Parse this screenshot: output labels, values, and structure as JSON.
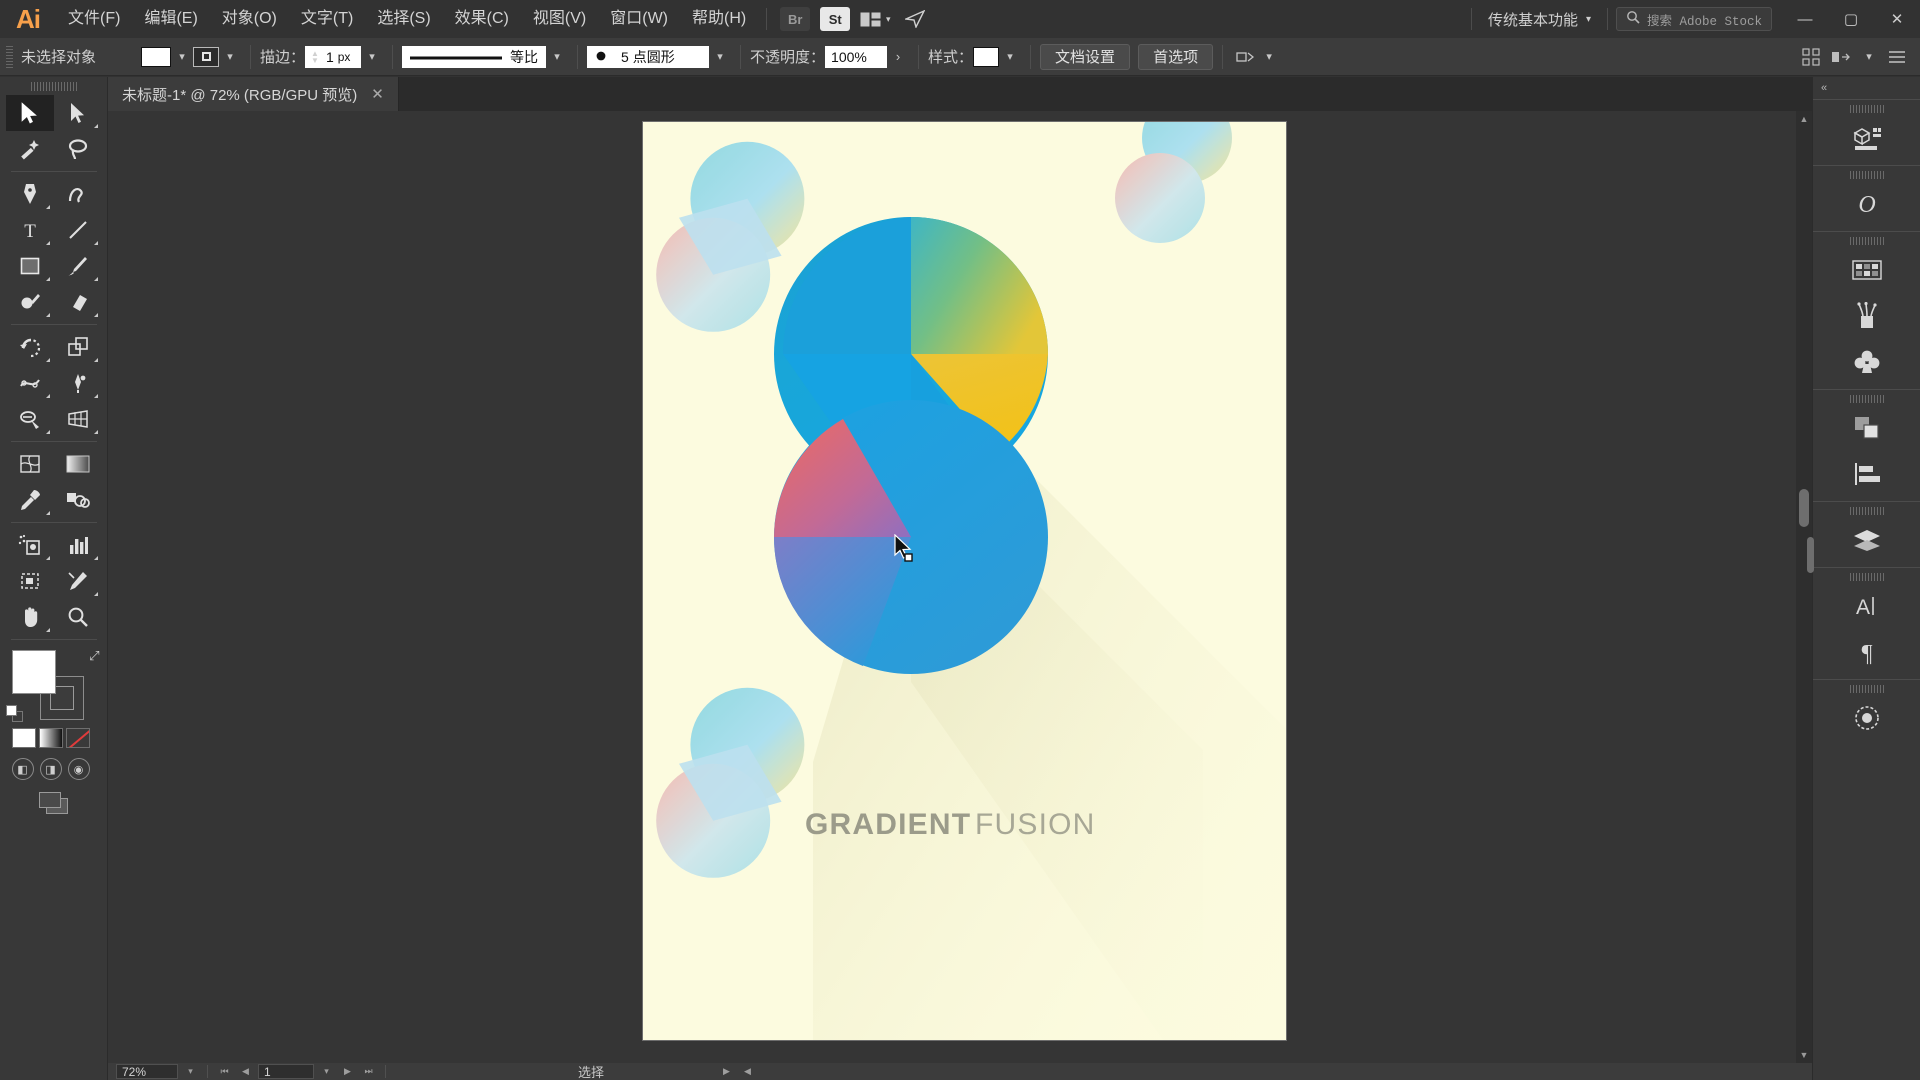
{
  "app": {
    "name": "Ai",
    "logo_color": "#f7a04b"
  },
  "menubar": {
    "items": [
      {
        "label": "文件(F)",
        "name": "file"
      },
      {
        "label": "编辑(E)",
        "name": "edit"
      },
      {
        "label": "对象(O)",
        "name": "object"
      },
      {
        "label": "文字(T)",
        "name": "type"
      },
      {
        "label": "选择(S)",
        "name": "select"
      },
      {
        "label": "效果(C)",
        "name": "effect"
      },
      {
        "label": "视图(V)",
        "name": "view"
      },
      {
        "label": "窗口(W)",
        "name": "window"
      },
      {
        "label": "帮助(H)",
        "name": "help"
      }
    ],
    "bridge_label": "Br",
    "stock_label": "St",
    "workspace": "传统基本功能",
    "search_placeholder": "搜索 Adobe Stock",
    "window_buttons": {
      "minimize": "—",
      "maximize": "▢",
      "close": "✕"
    }
  },
  "controlbar": {
    "selection_status": "未选择对象",
    "fill_color": "#ffffff",
    "stroke_label": "描边：",
    "stroke_weight": "1",
    "stroke_unit": "px",
    "stroke_profile": "等比",
    "brush_definition": "5 点圆形",
    "opacity_label": "不透明度：",
    "opacity_value": "100%",
    "style_label": "样式：",
    "style_color": "#ffffff",
    "document_setup": "文档设置",
    "preferences": "首选项"
  },
  "tab": {
    "title": "未标题-1* @ 72% (RGB/GPU 预览)",
    "close": "✕"
  },
  "toolbar": {
    "tools": [
      {
        "name": "selection-tool",
        "label": "选择工具",
        "active": true
      },
      {
        "name": "direct-selection-tool",
        "label": "直接选择工具",
        "active": false
      },
      {
        "name": "magic-wand-tool",
        "label": "魔棒工具",
        "active": false
      },
      {
        "name": "lasso-tool",
        "label": "套索工具",
        "active": false
      },
      {
        "name": "pen-tool",
        "label": "钢笔工具",
        "active": false
      },
      {
        "name": "curvature-tool",
        "label": "曲率工具",
        "active": false
      },
      {
        "name": "type-tool",
        "label": "文字工具",
        "active": false
      },
      {
        "name": "line-segment-tool",
        "label": "直线段工具",
        "active": false
      },
      {
        "name": "rectangle-tool",
        "label": "矩形工具",
        "active": false
      },
      {
        "name": "paintbrush-tool",
        "label": "画笔工具",
        "active": false
      },
      {
        "name": "shaper-tool",
        "label": "Shaper 工具",
        "active": false
      },
      {
        "name": "eraser-tool",
        "label": "橡皮擦工具",
        "active": false
      },
      {
        "name": "rotate-tool",
        "label": "旋转工具",
        "active": false
      },
      {
        "name": "scale-tool",
        "label": "比例缩放工具",
        "active": false
      },
      {
        "name": "width-tool",
        "label": "宽度工具",
        "active": false
      },
      {
        "name": "free-transform-tool",
        "label": "自由变换工具",
        "active": false
      },
      {
        "name": "shape-builder-tool",
        "label": "形状生成器工具",
        "active": false
      },
      {
        "name": "perspective-grid-tool",
        "label": "透视网格工具",
        "active": false
      },
      {
        "name": "mesh-tool",
        "label": "网格工具",
        "active": false
      },
      {
        "name": "gradient-tool",
        "label": "渐变工具",
        "active": false
      },
      {
        "name": "eyedropper-tool",
        "label": "吸管工具",
        "active": false
      },
      {
        "name": "blend-tool",
        "label": "混合工具",
        "active": false
      },
      {
        "name": "symbol-sprayer-tool",
        "label": "符号喷枪工具",
        "active": false
      },
      {
        "name": "column-graph-tool",
        "label": "柱形图工具",
        "active": false
      },
      {
        "name": "artboard-tool",
        "label": "画板工具",
        "active": false
      },
      {
        "name": "slice-tool",
        "label": "切片工具",
        "active": false
      },
      {
        "name": "hand-tool",
        "label": "抓手工具",
        "active": false
      },
      {
        "name": "zoom-tool",
        "label": "缩放工具",
        "active": false
      }
    ],
    "fill_color": "#ffffff",
    "stroke_color": "#3c3c3c",
    "color_modes": [
      "color-fill",
      "gradient-fill",
      "none-fill"
    ],
    "draw_modes": [
      "draw-normal",
      "draw-behind",
      "draw-inside"
    ]
  },
  "canvas": {
    "background": "#353535",
    "artboard_background": "#fcfbdf",
    "poster": {
      "title_bold": "GRADIENT",
      "title_light": " FUSION",
      "title_color": "#9b9b8a"
    }
  },
  "statusbar": {
    "zoom": "72%",
    "page_number": "1",
    "tool_status": "选择",
    "nav_first": "⏮",
    "nav_prev": "◀",
    "nav_next": "▶",
    "nav_last": "⏭"
  },
  "rightdock": {
    "groups": [
      {
        "items": [
          {
            "name": "libraries-panel-icon",
            "label": "库"
          }
        ]
      },
      {
        "items": [
          {
            "name": "character-styles-panel-icon",
            "label": "字符样式"
          }
        ]
      },
      {
        "items": [
          {
            "name": "swatches-panel-icon",
            "label": "色板"
          },
          {
            "name": "brushes-panel-icon",
            "label": "画笔"
          },
          {
            "name": "symbols-panel-icon",
            "label": "符号"
          }
        ]
      },
      {
        "items": [
          {
            "name": "pathfinder-panel-icon",
            "label": "路径查找器"
          },
          {
            "name": "align-panel-icon",
            "label": "对齐"
          }
        ]
      },
      {
        "items": [
          {
            "name": "layers-panel-icon",
            "label": "图层"
          }
        ]
      },
      {
        "items": [
          {
            "name": "character-panel-icon",
            "label": "字符"
          },
          {
            "name": "paragraph-panel-icon",
            "label": "段落"
          }
        ]
      },
      {
        "items": [
          {
            "name": "appearance-panel-icon",
            "label": "外观"
          }
        ]
      }
    ],
    "collapse_label": "«"
  }
}
